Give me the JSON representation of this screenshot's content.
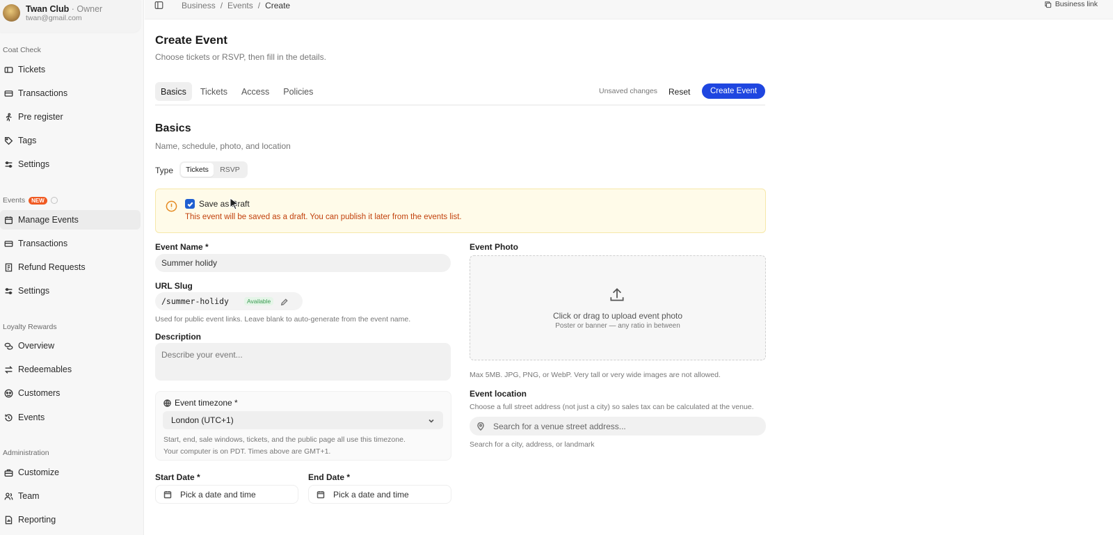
{
  "account": {
    "name": "Twan Club",
    "role": "· Owner",
    "email": "twan@gmail.com"
  },
  "sidebar": {
    "sections": [
      {
        "label": "Coat Check",
        "items": [
          {
            "label": "Tickets",
            "icon": "ticket-icon"
          },
          {
            "label": "Transactions",
            "icon": "card-icon"
          },
          {
            "label": "Pre register",
            "icon": "person-run-icon"
          },
          {
            "label": "Tags",
            "icon": "tag-icon"
          },
          {
            "label": "Settings",
            "icon": "sliders-icon"
          }
        ]
      },
      {
        "label": "Events",
        "badge": "NEW",
        "items": [
          {
            "label": "Manage Events",
            "icon": "calendar-icon",
            "active": true
          },
          {
            "label": "Transactions",
            "icon": "card-icon"
          },
          {
            "label": "Refund Requests",
            "icon": "receipt-icon"
          },
          {
            "label": "Settings",
            "icon": "sliders-icon"
          }
        ]
      },
      {
        "label": "Loyalty Rewards",
        "items": [
          {
            "label": "Overview",
            "icon": "coins-icon"
          },
          {
            "label": "Redeemables",
            "icon": "swap-icon"
          },
          {
            "label": "Customers",
            "icon": "users-icon"
          },
          {
            "label": "Events",
            "icon": "history-icon"
          }
        ]
      },
      {
        "label": "Administration",
        "items": [
          {
            "label": "Customize",
            "icon": "briefcase-icon"
          },
          {
            "label": "Team",
            "icon": "team-icon"
          },
          {
            "label": "Reporting",
            "icon": "report-icon"
          }
        ]
      }
    ]
  },
  "topbar": {
    "breadcrumbs": [
      "Business",
      "/",
      "Events",
      "/",
      "Create"
    ],
    "business_link": "Business link"
  },
  "page": {
    "title": "Create Event",
    "subtitle": "Choose tickets or RSVP, then fill in the details."
  },
  "tabs": [
    {
      "label": "Basics",
      "active": true
    },
    {
      "label": "Tickets"
    },
    {
      "label": "Access"
    },
    {
      "label": "Policies"
    }
  ],
  "actions": {
    "unsaved": "Unsaved changes",
    "reset": "Reset",
    "create": "Create Event"
  },
  "basics": {
    "title": "Basics",
    "subtitle": "Name, schedule, photo, and location",
    "type_label": "Type",
    "type_options": [
      "Tickets",
      "RSVP"
    ],
    "type_selected": "Tickets"
  },
  "draft": {
    "checked": true,
    "label": "Save as Draft",
    "message": "This event will be saved as a draft. You can publish it later from the events list."
  },
  "form": {
    "event_name": {
      "label": "Event Name *",
      "value": "Summer holidy"
    },
    "url_slug": {
      "label": "URL Slug",
      "value": "/summer-holidy",
      "status": "Available",
      "help": "Used for public event links. Leave blank to auto-generate from the event name."
    },
    "description": {
      "label": "Description",
      "placeholder": "Describe your event..."
    },
    "timezone": {
      "label": "Event timezone *",
      "value": "London (UTC+1)",
      "note1": "Start, end, sale windows, tickets, and the public page all use this timezone.",
      "note2": "Your computer is on PDT. Times above are GMT+1."
    },
    "start_date": {
      "label": "Start Date *",
      "placeholder": "Pick a date and time"
    },
    "end_date": {
      "label": "End Date *",
      "placeholder": "Pick a date and time"
    },
    "photo": {
      "label": "Event Photo",
      "title": "Click or drag to upload event photo",
      "subtitle": "Poster or banner — any ratio in between",
      "help": "Max 5MB. JPG, PNG, or WebP. Very tall or very wide images are not allowed."
    },
    "location": {
      "label": "Event location",
      "help": "Choose a full street address (not just a city) so sales tax can be calculated at the venue.",
      "placeholder": "Search for a venue street address...",
      "hint": "Search for a city, address, or landmark"
    }
  },
  "colors": {
    "primary": "#1f46e0",
    "warning_text": "#c2410c",
    "warning_bg": "#fffbe9",
    "badge_new": "#f05a22",
    "available": "#3a9a52"
  }
}
